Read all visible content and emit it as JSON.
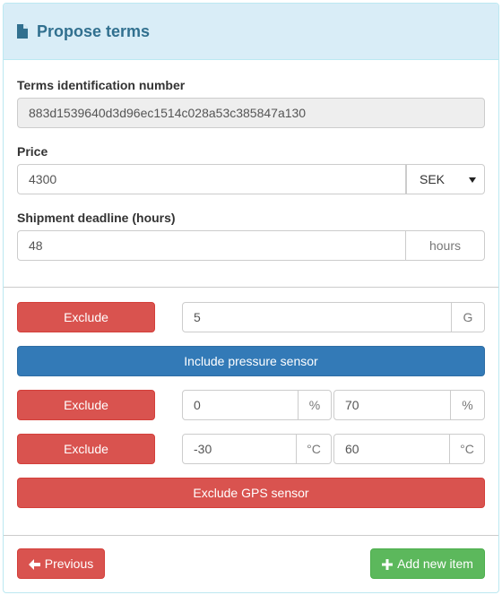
{
  "header": {
    "title": "Propose terms",
    "icon": "document-icon",
    "color": "#31708f",
    "background": "#d9edf7"
  },
  "form": {
    "terms_id": {
      "label": "Terms identification number",
      "value": "883d1539640d3d96ec1514c028a53c385847a130"
    },
    "price": {
      "label": "Price",
      "value": "4300",
      "currency": "SEK"
    },
    "deadline": {
      "label": "Shipment deadline (hours)",
      "value": "48",
      "unit": "hours"
    }
  },
  "sensors": {
    "acceleration": {
      "button": "Exclude",
      "value": "5",
      "unit": "G"
    },
    "pressure": {
      "button": "Include pressure sensor"
    },
    "humidity": {
      "button": "Exclude",
      "min": "0",
      "min_unit": "%",
      "max": "70",
      "max_unit": "%"
    },
    "temperature": {
      "button": "Exclude",
      "min": "-30",
      "min_unit": "°C",
      "max": "60",
      "max_unit": "°C"
    },
    "gps": {
      "button": "Exclude GPS sensor"
    }
  },
  "footer": {
    "previous": "Previous",
    "add": "Add new item"
  },
  "colors": {
    "danger": "#d9534f",
    "primary": "#337ab7",
    "success": "#5cb85c"
  }
}
